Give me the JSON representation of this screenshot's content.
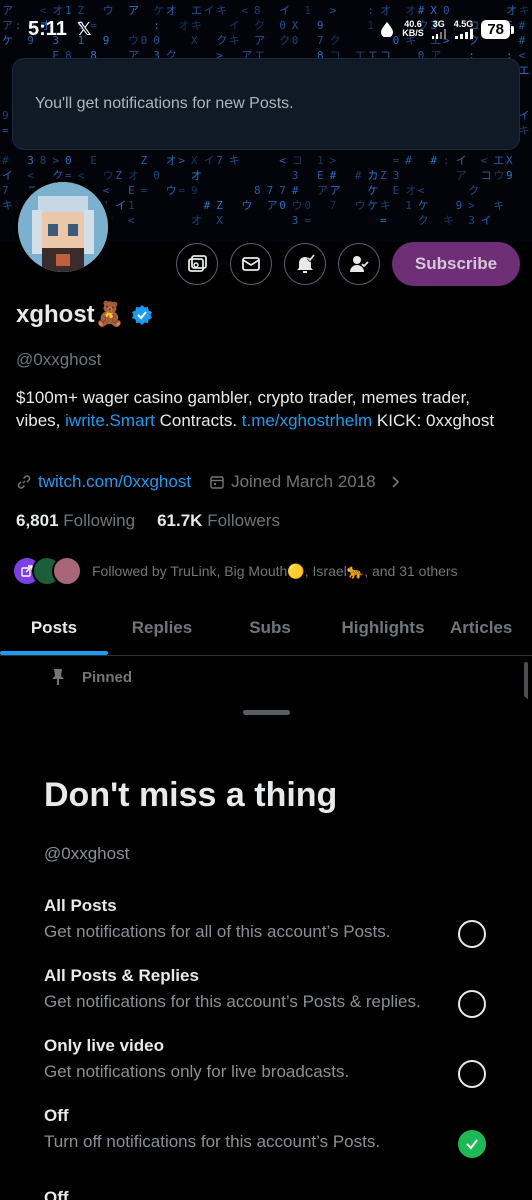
{
  "status_bar": {
    "time": "5:11",
    "x_label": "𝕏",
    "net_speed_value": "40.6",
    "net_speed_unit": "KB/S",
    "sig1": "3G",
    "sig2": "4.5G",
    "battery": "78"
  },
  "toast": {
    "text": "You'll get notifications for new Posts."
  },
  "profile": {
    "display_name": "xghost🧸",
    "handle": "@0xxghost",
    "bio_1": "$100m+ wager casino gambler, crypto trader, memes trader, vibes, ",
    "bio_link_1": "iwrite.Smart",
    "bio_2": " Contracts. ",
    "bio_link_2": "t.me/xghostrhelm",
    "bio_3": " KICK: 0xxghost",
    "website": "twitch.com/0xxghost",
    "joined": "Joined March 2018",
    "following_count": "6,801",
    "following_label": "Following",
    "followers_count": "61.7K",
    "followers_label": "Followers",
    "followed_by": "Followed by TruLink, Big Mouth🟡, Israel🐆, and 31 others",
    "subscribe_label": "Subscribe"
  },
  "tabs": [
    {
      "label": "Posts"
    },
    {
      "label": "Replies"
    },
    {
      "label": "Subs"
    },
    {
      "label": "Highlights"
    },
    {
      "label": "Articles"
    }
  ],
  "pinned_label": "Pinned",
  "sheet": {
    "title": "Don't miss a thing",
    "handle": "@0xxghost",
    "options": [
      {
        "title": "All Posts",
        "desc": "Get notifications for all of this account’s Posts.",
        "selected": false
      },
      {
        "title": "All Posts & Replies",
        "desc": "Get notifications for this account’s Posts & replies.",
        "selected": false
      },
      {
        "title": "Only live video",
        "desc": "Get notifications only for live broadcasts.",
        "selected": false
      },
      {
        "title": "Off",
        "desc": "Turn off notifications for this account’s Posts.",
        "selected": true
      }
    ],
    "peek_text": "Off"
  },
  "colors": {
    "accent_blue": "#1d9bf0",
    "subscribe_purple": "#6e2f77",
    "selected_green": "#1db954",
    "banner_matrix": "#2f7fe0"
  },
  "icons": [
    "x-logo-icon",
    "data-saver-icon",
    "signal-icon",
    "battery-icon",
    "media-icon",
    "mail-icon",
    "bell-check-icon",
    "user-check-icon",
    "verified-badge-icon",
    "link-icon",
    "calendar-icon",
    "chevron-right-icon",
    "pin-icon",
    "checkmark-icon"
  ]
}
